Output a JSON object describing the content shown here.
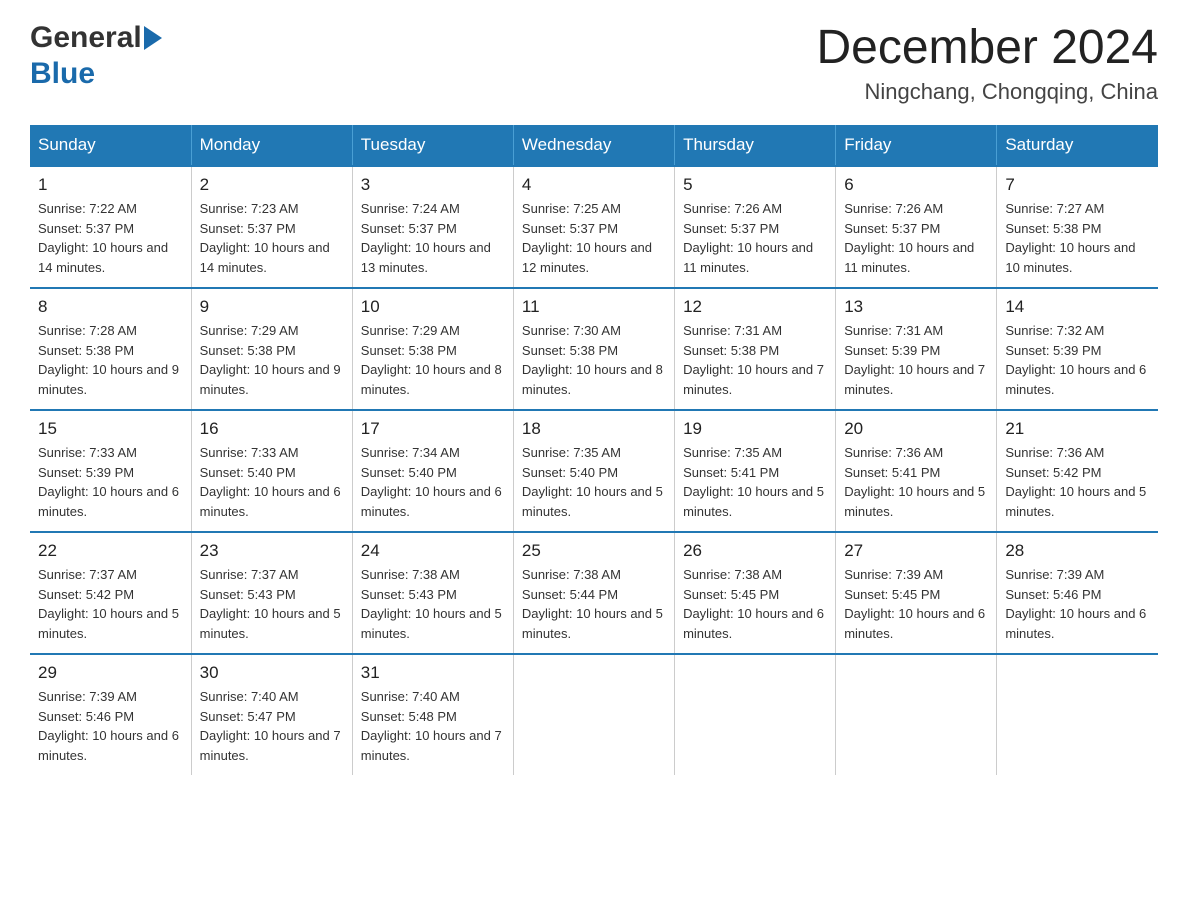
{
  "logo": {
    "general": "General",
    "blue": "Blue"
  },
  "title": "December 2024",
  "location": "Ningchang, Chongqing, China",
  "weekdays": [
    "Sunday",
    "Monday",
    "Tuesday",
    "Wednesday",
    "Thursday",
    "Friday",
    "Saturday"
  ],
  "weeks": [
    [
      {
        "day": "1",
        "sunrise": "7:22 AM",
        "sunset": "5:37 PM",
        "daylight": "10 hours and 14 minutes."
      },
      {
        "day": "2",
        "sunrise": "7:23 AM",
        "sunset": "5:37 PM",
        "daylight": "10 hours and 14 minutes."
      },
      {
        "day": "3",
        "sunrise": "7:24 AM",
        "sunset": "5:37 PM",
        "daylight": "10 hours and 13 minutes."
      },
      {
        "day": "4",
        "sunrise": "7:25 AM",
        "sunset": "5:37 PM",
        "daylight": "10 hours and 12 minutes."
      },
      {
        "day": "5",
        "sunrise": "7:26 AM",
        "sunset": "5:37 PM",
        "daylight": "10 hours and 11 minutes."
      },
      {
        "day": "6",
        "sunrise": "7:26 AM",
        "sunset": "5:37 PM",
        "daylight": "10 hours and 11 minutes."
      },
      {
        "day": "7",
        "sunrise": "7:27 AM",
        "sunset": "5:38 PM",
        "daylight": "10 hours and 10 minutes."
      }
    ],
    [
      {
        "day": "8",
        "sunrise": "7:28 AM",
        "sunset": "5:38 PM",
        "daylight": "10 hours and 9 minutes."
      },
      {
        "day": "9",
        "sunrise": "7:29 AM",
        "sunset": "5:38 PM",
        "daylight": "10 hours and 9 minutes."
      },
      {
        "day": "10",
        "sunrise": "7:29 AM",
        "sunset": "5:38 PM",
        "daylight": "10 hours and 8 minutes."
      },
      {
        "day": "11",
        "sunrise": "7:30 AM",
        "sunset": "5:38 PM",
        "daylight": "10 hours and 8 minutes."
      },
      {
        "day": "12",
        "sunrise": "7:31 AM",
        "sunset": "5:38 PM",
        "daylight": "10 hours and 7 minutes."
      },
      {
        "day": "13",
        "sunrise": "7:31 AM",
        "sunset": "5:39 PM",
        "daylight": "10 hours and 7 minutes."
      },
      {
        "day": "14",
        "sunrise": "7:32 AM",
        "sunset": "5:39 PM",
        "daylight": "10 hours and 6 minutes."
      }
    ],
    [
      {
        "day": "15",
        "sunrise": "7:33 AM",
        "sunset": "5:39 PM",
        "daylight": "10 hours and 6 minutes."
      },
      {
        "day": "16",
        "sunrise": "7:33 AM",
        "sunset": "5:40 PM",
        "daylight": "10 hours and 6 minutes."
      },
      {
        "day": "17",
        "sunrise": "7:34 AM",
        "sunset": "5:40 PM",
        "daylight": "10 hours and 6 minutes."
      },
      {
        "day": "18",
        "sunrise": "7:35 AM",
        "sunset": "5:40 PM",
        "daylight": "10 hours and 5 minutes."
      },
      {
        "day": "19",
        "sunrise": "7:35 AM",
        "sunset": "5:41 PM",
        "daylight": "10 hours and 5 minutes."
      },
      {
        "day": "20",
        "sunrise": "7:36 AM",
        "sunset": "5:41 PM",
        "daylight": "10 hours and 5 minutes."
      },
      {
        "day": "21",
        "sunrise": "7:36 AM",
        "sunset": "5:42 PM",
        "daylight": "10 hours and 5 minutes."
      }
    ],
    [
      {
        "day": "22",
        "sunrise": "7:37 AM",
        "sunset": "5:42 PM",
        "daylight": "10 hours and 5 minutes."
      },
      {
        "day": "23",
        "sunrise": "7:37 AM",
        "sunset": "5:43 PM",
        "daylight": "10 hours and 5 minutes."
      },
      {
        "day": "24",
        "sunrise": "7:38 AM",
        "sunset": "5:43 PM",
        "daylight": "10 hours and 5 minutes."
      },
      {
        "day": "25",
        "sunrise": "7:38 AM",
        "sunset": "5:44 PM",
        "daylight": "10 hours and 5 minutes."
      },
      {
        "day": "26",
        "sunrise": "7:38 AM",
        "sunset": "5:45 PM",
        "daylight": "10 hours and 6 minutes."
      },
      {
        "day": "27",
        "sunrise": "7:39 AM",
        "sunset": "5:45 PM",
        "daylight": "10 hours and 6 minutes."
      },
      {
        "day": "28",
        "sunrise": "7:39 AM",
        "sunset": "5:46 PM",
        "daylight": "10 hours and 6 minutes."
      }
    ],
    [
      {
        "day": "29",
        "sunrise": "7:39 AM",
        "sunset": "5:46 PM",
        "daylight": "10 hours and 6 minutes."
      },
      {
        "day": "30",
        "sunrise": "7:40 AM",
        "sunset": "5:47 PM",
        "daylight": "10 hours and 7 minutes."
      },
      {
        "day": "31",
        "sunrise": "7:40 AM",
        "sunset": "5:48 PM",
        "daylight": "10 hours and 7 minutes."
      },
      null,
      null,
      null,
      null
    ]
  ],
  "labels": {
    "sunrise": "Sunrise: ",
    "sunset": "Sunset: ",
    "daylight": "Daylight: "
  }
}
